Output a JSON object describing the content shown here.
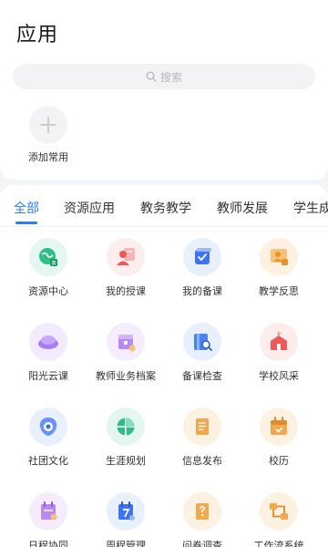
{
  "header": {
    "title": "应用"
  },
  "search": {
    "placeholder": "搜索"
  },
  "common": {
    "add_label": "添加常用"
  },
  "tabs": [
    {
      "label": "全部",
      "active": true
    },
    {
      "label": "资源应用"
    },
    {
      "label": "教务教学"
    },
    {
      "label": "教师发展"
    },
    {
      "label": "学生成"
    }
  ],
  "apps": [
    {
      "label": "资源中心",
      "icon": "resource-center-icon"
    },
    {
      "label": "我的授课",
      "icon": "teaching-icon"
    },
    {
      "label": "我的备课",
      "icon": "lesson-prep-icon"
    },
    {
      "label": "教学反思",
      "icon": "reflection-icon"
    },
    {
      "label": "阳光云课",
      "icon": "cloud-class-icon"
    },
    {
      "label": "教师业务档案",
      "icon": "teacher-archive-icon"
    },
    {
      "label": "备课检查",
      "icon": "lesson-check-icon"
    },
    {
      "label": "学校风采",
      "icon": "school-style-icon"
    },
    {
      "label": "社团文化",
      "icon": "club-culture-icon"
    },
    {
      "label": "生涯规划",
      "icon": "career-plan-icon"
    },
    {
      "label": "信息发布",
      "icon": "info-publish-icon"
    },
    {
      "label": "校历",
      "icon": "school-calendar-icon"
    },
    {
      "label": "日程协同",
      "icon": "schedule-sync-icon"
    },
    {
      "label": "周程管理",
      "icon": "weekly-schedule-icon"
    },
    {
      "label": "问卷调查",
      "icon": "survey-icon"
    },
    {
      "label": "工作流系统",
      "icon": "workflow-icon"
    }
  ],
  "colors": {
    "accent": "#2f7df6",
    "background": "#f4f5f7"
  }
}
